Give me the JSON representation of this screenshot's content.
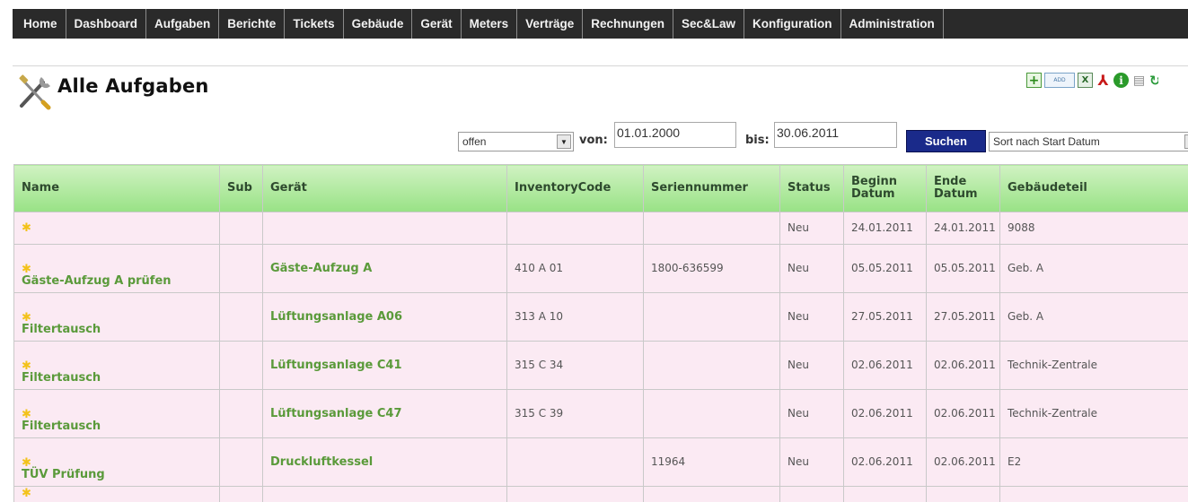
{
  "nav": {
    "items": [
      "Home",
      "Dashboard",
      "Aufgaben",
      "Berichte",
      "Tickets",
      "Gebäude",
      "Gerät",
      "Meters",
      "Verträge",
      "Rechnungen",
      "Sec&Law",
      "Konfiguration",
      "Administration"
    ]
  },
  "page": {
    "title": "Alle Aufgaben"
  },
  "toolbar": {
    "add_label": "ADD"
  },
  "filter": {
    "status_value": "offen",
    "von_label": "von:",
    "von_value": "01.01.2000",
    "bis_label": "bis:",
    "bis_value": "30.06.2011",
    "search_label": "Suchen",
    "sort_value": "Sort nach Start Datum"
  },
  "table": {
    "headers": [
      "Name",
      "Sub",
      "Gerät",
      "InventoryCode",
      "Seriennummer",
      "Status",
      "Beginn Datum",
      "Ende Datum",
      "Gebäudeteil"
    ],
    "rows": [
      {
        "name": "",
        "sub": "",
        "geraet": "",
        "inventory": "",
        "serial": "",
        "status": "Neu",
        "begin": "24.01.2011",
        "end": "24.01.2011",
        "part": "9088"
      },
      {
        "name": "Gäste-Aufzug A prüfen",
        "sub": "",
        "geraet": "Gäste-Aufzug A",
        "inventory": "410 A 01",
        "serial": "1800-636599",
        "status": "Neu",
        "begin": "05.05.2011",
        "end": "05.05.2011",
        "part": "Geb. A"
      },
      {
        "name": "Filtertausch",
        "sub": "",
        "geraet": "Lüftungsanlage A06",
        "inventory": "313 A 10",
        "serial": "",
        "status": "Neu",
        "begin": "27.05.2011",
        "end": "27.05.2011",
        "part": "Geb. A"
      },
      {
        "name": "Filtertausch",
        "sub": "",
        "geraet": "Lüftungsanlage C41",
        "inventory": "315 C 34",
        "serial": "",
        "status": "Neu",
        "begin": "02.06.2011",
        "end": "02.06.2011",
        "part": "Technik-Zentrale"
      },
      {
        "name": "Filtertausch",
        "sub": "",
        "geraet": "Lüftungsanlage C47",
        "inventory": "315 C 39",
        "serial": "",
        "status": "Neu",
        "begin": "02.06.2011",
        "end": "02.06.2011",
        "part": "Technik-Zentrale"
      },
      {
        "name": "TÜV Prüfung",
        "sub": "",
        "geraet": "Druckluftkessel",
        "inventory": "",
        "serial": "11964",
        "status": "Neu",
        "begin": "02.06.2011",
        "end": "02.06.2011",
        "part": "E2"
      }
    ]
  },
  "colors": {
    "nav_bg": "#2a2a2a",
    "header_green": "#98e285",
    "row_pink": "#fbeaf3",
    "link_green": "#5a9a3a",
    "search_button": "#1a2a8a"
  }
}
